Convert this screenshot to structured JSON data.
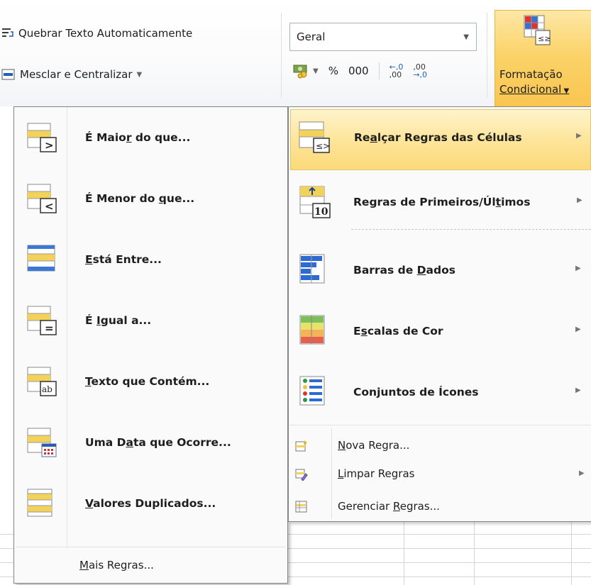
{
  "ribbon": {
    "wrap_text_pre": "Quebrar Texto Automaticamente",
    "merge_center_pre": "Mesclar e Centralizar",
    "number_format_value": "Geral",
    "percent": "%",
    "thousands": "000",
    "inc_decimal_top": "←,0",
    "inc_decimal_bottom": ",00",
    "dec_decimal_top": ",00",
    "dec_decimal_bottom": "→,0",
    "cond_format_line1": "Formatação",
    "cond_format_line2": "Condicional"
  },
  "submenu": {
    "items": [
      {
        "label_pre": "É Maio",
        "accel": "r",
        "label_post": " do que..."
      },
      {
        "label_pre": "É Menor do ",
        "accel": "q",
        "label_post": "ue..."
      },
      {
        "label_pre": "",
        "accel": "E",
        "label_post": "stá Entre..."
      },
      {
        "label_pre": "É ",
        "accel": "I",
        "label_post": "gual a..."
      },
      {
        "label_pre": "",
        "accel": "T",
        "label_post": "exto que Contém..."
      },
      {
        "label_pre": "Uma D",
        "accel": "a",
        "label_post": "ta que Ocorre..."
      },
      {
        "label_pre": "",
        "accel": "V",
        "label_post": "alores Duplicados..."
      }
    ],
    "more_rules": {
      "label_pre": "",
      "accel": "M",
      "label_post": "ais Regras..."
    }
  },
  "menu": {
    "items": [
      {
        "label_pre": "Re",
        "accel": "a",
        "label_post": "lçar Regras das Células"
      },
      {
        "label_pre": "Regras de Primeiros/Úl",
        "accel": "t",
        "label_post": "imos"
      },
      {
        "label_pre": "Barras de ",
        "accel": "D",
        "label_post": "ados"
      },
      {
        "label_pre": "E",
        "accel": "s",
        "label_post": "calas de Cor"
      },
      {
        "label_pre": "Con",
        "accel": "j",
        "label_post": "untos de Ícones"
      }
    ],
    "small_items": [
      {
        "label_pre": "",
        "accel": "N",
        "label_post": "ova Regra..."
      },
      {
        "label_pre": "",
        "accel": "L",
        "label_post": "impar Regras"
      },
      {
        "label_pre": "Gerenciar ",
        "accel": "R",
        "label_post": "egras..."
      }
    ],
    "top10_badge": "10"
  },
  "colors": {
    "highlight": "#fde59b",
    "accent_blue": "#2d6bd1",
    "accent_yellow": "#f3d25a"
  }
}
